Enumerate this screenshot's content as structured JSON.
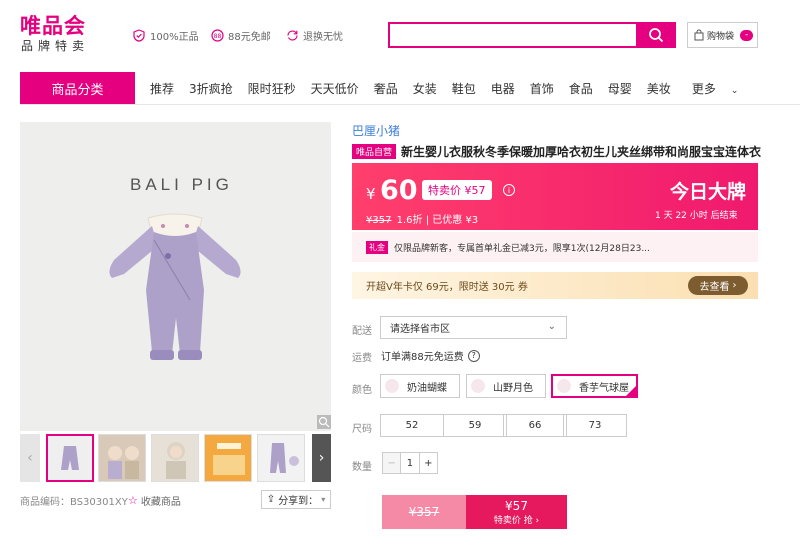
{
  "header": {
    "logo": "唯品会",
    "slogan": "品牌特卖",
    "promises": [
      "100%正品",
      "88元免邮",
      "退换无忧"
    ],
    "search": {
      "value": "",
      "placeholder": ""
    },
    "cart": {
      "label": "购物袋",
      "count": "-"
    }
  },
  "nav": {
    "category_label": "商品分类",
    "items": [
      "推荐",
      "3折疯抢",
      "限时狂秒",
      "天天低价",
      "奢品",
      "女装",
      "鞋包",
      "电器",
      "首饰",
      "食品",
      "母婴",
      "美妆",
      "更多"
    ]
  },
  "gallery": {
    "brand_text": "BALI PIG",
    "product_code": "商品编码：BS30301XY",
    "favorite_label": "收藏商品",
    "share_label": "分享到："
  },
  "product": {
    "brand": "巴厘小猪",
    "self_tag": "唯品自营",
    "title": "新生婴儿衣服秋冬季保暖加厚哈衣初生儿夹丝绑带和尚服宝宝连体衣",
    "currency": "¥",
    "price": "60",
    "special_price": "特卖价 ¥57",
    "original_price": "¥357",
    "discount": "1.6折 | 已优惠 ¥3",
    "today_label": "今日大牌",
    "countdown": "1 天 22 小时 后结束",
    "coupon_tag": "礼金",
    "coupon_text": "仅限品牌新客，专属首单礼金已减3元，限享1次(12月28日23...",
    "vip_text": "开超V年卡仅 69元，限时送 30元 券",
    "vip_button": "去查看"
  },
  "options": {
    "delivery_label": "配送",
    "address_select": "请选择省市区",
    "freight_label": "运费",
    "freight_text": "订单满88元免运费",
    "color_label": "颜色",
    "colors": [
      "奶油蝴蝶",
      "山野月色",
      "香芋气球屋"
    ],
    "size_label": "尺码",
    "sizes": [
      "52",
      "59",
      "66",
      "73"
    ],
    "quantity_label": "数量",
    "quantity": "1",
    "minus": "−",
    "plus": "+"
  },
  "buy": {
    "original": "¥357",
    "special_price": "¥57",
    "action": "特卖价 抢 ›"
  },
  "colors": {
    "accent": "#e4007f",
    "price_bar": "#ff3f6c",
    "vip_button": "#7d5c30"
  }
}
